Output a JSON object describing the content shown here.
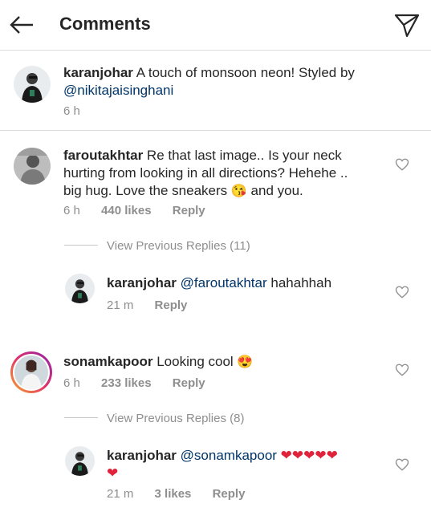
{
  "header": {
    "title": "Comments"
  },
  "caption": {
    "username": "karanjohar",
    "text": "A touch of monsoon neon! Styled by",
    "mention": "@nikitajaisinghani",
    "time": "6 h"
  },
  "comments": [
    {
      "username": "faroutakhtar",
      "text_line1": "Re that last image.. Is your neck",
      "text_line2": "hurting from looking in all directions? Hehehe ..",
      "text_line3": "big hug. Love the sneakers",
      "emoji": "😘",
      "text_tail": "and you.",
      "time": "6 h",
      "likes": "440 likes",
      "reply_label": "Reply",
      "view_replies": "View Previous Replies (11)",
      "reply": {
        "username": "karanjohar",
        "mention": "@faroutakhtar",
        "text": "hahahhah",
        "time": "21 m",
        "reply_label": "Reply"
      }
    },
    {
      "username": "sonamkapoor",
      "text": "Looking cool",
      "emoji": "😍",
      "time": "6 h",
      "likes": "233 likes",
      "reply_label": "Reply",
      "view_replies": "View Previous Replies (8)",
      "reply": {
        "username": "karanjohar",
        "mention": "@sonamkapoor",
        "hearts_line1": "❤❤❤❤❤",
        "hearts_line2": "❤",
        "time": "21 m",
        "likes": "3 likes",
        "reply_label": "Reply"
      }
    }
  ]
}
